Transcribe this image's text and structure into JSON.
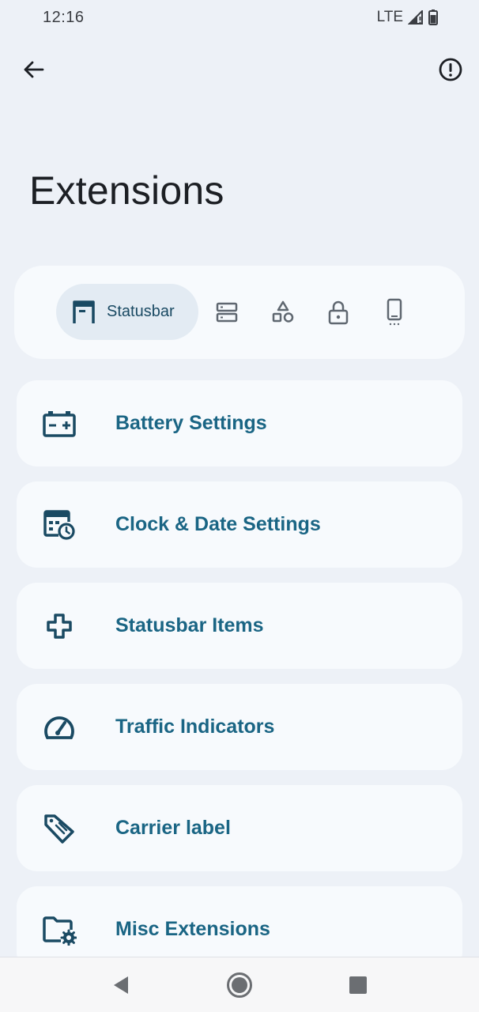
{
  "status_bar": {
    "time": "12:16",
    "network": "LTE"
  },
  "header": {
    "title": "Extensions"
  },
  "categories": {
    "active_label": "Statusbar",
    "items": [
      "statusbar-icon",
      "quick-settings-icon",
      "shapes-icon",
      "lock-icon",
      "phone-icon"
    ]
  },
  "settings": [
    {
      "label": "Battery Settings",
      "icon": "battery-icon"
    },
    {
      "label": "Clock & Date Settings",
      "icon": "calendar-clock-icon"
    },
    {
      "label": "Statusbar Items",
      "icon": "plus-icon"
    },
    {
      "label": "Traffic Indicators",
      "icon": "speedometer-icon"
    },
    {
      "label": "Carrier label",
      "icon": "tag-icon"
    },
    {
      "label": "Misc Extensions",
      "icon": "folder-gear-icon"
    }
  ],
  "colors": {
    "background": "#edf1f7",
    "card": "#f7fafd",
    "accent_text": "#1a6584",
    "icon": "#1a4a63",
    "inactive_icon": "#5f6770"
  }
}
